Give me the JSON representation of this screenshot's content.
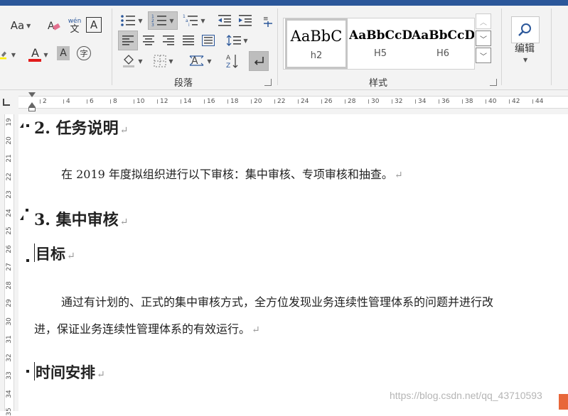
{
  "ribbon": {
    "font": {
      "change_case_label": "Aa",
      "phonetic_label_top": "wén",
      "phonetic_label_bottom": "文",
      "char_border_label": "A",
      "font_color_label": "A",
      "shading_label": "A",
      "enclose_char_label": "字"
    },
    "paragraph": {
      "group_label": "段落"
    },
    "styles": {
      "group_label": "样式",
      "items": [
        {
          "preview": "AaBbC",
          "name": "h2"
        },
        {
          "preview": "AaBbCcD",
          "name": "H5"
        },
        {
          "preview": "AaBbCcD",
          "name": "H6"
        }
      ]
    },
    "editing": {
      "label": "编辑"
    }
  },
  "ruler": {
    "numbers": [
      "2",
      "4",
      "6",
      "8",
      "10",
      "12",
      "14",
      "16",
      "18",
      "20",
      "22",
      "24",
      "26",
      "28",
      "30",
      "32",
      "34",
      "36",
      "38",
      "40",
      "42",
      "44"
    ]
  },
  "vruler": {
    "numbers": [
      "19",
      "20",
      "21",
      "22",
      "23",
      "24",
      "25",
      "26",
      "27",
      "28",
      "29",
      "30",
      "31",
      "32",
      "33",
      "34",
      "35"
    ]
  },
  "document": {
    "heading_2": "2. 任务说明",
    "para_1": "在 2019 年度拟组织进行以下审核：集中审核、专项审核和抽查。",
    "heading_3": "3. 集中审核",
    "subheading_goal": "目标",
    "para_2_line1": "通过有计划的、正式的集中审核方式，全方位发现业务连续性管理体系的问题并进行改",
    "para_2_line2": "进，保证业务连续性管理体系的有效运行。",
    "subheading_schedule": "时间安排",
    "paragraph_mark": "↵"
  },
  "watermark": "https://blog.csdn.net/qq_43710593"
}
